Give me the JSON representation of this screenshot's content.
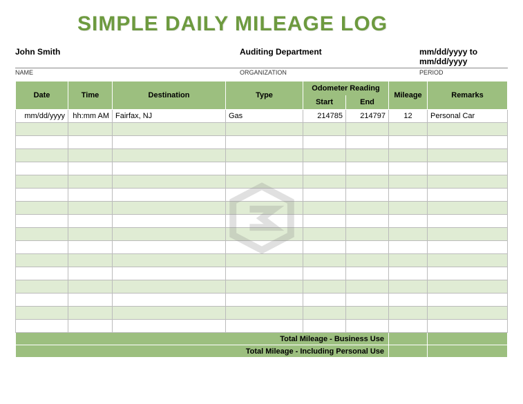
{
  "title": "SIMPLE DAILY MILEAGE LOG",
  "meta": {
    "name_value": "John Smith",
    "name_label": "NAME",
    "org_value": "Auditing Department",
    "org_label": "ORGANIZATION",
    "period_value": "mm/dd/yyyy to mm/dd/yyyy",
    "period_label": "PERIOD"
  },
  "headers": {
    "date": "Date",
    "time": "Time",
    "destination": "Destination",
    "type": "Type",
    "odometer": "Odometer Reading",
    "start": "Start",
    "end": "End",
    "mileage": "Mileage",
    "remarks": "Remarks"
  },
  "rows": [
    {
      "date": "mm/dd/yyyy",
      "time": "hh:mm AM",
      "destination": "Fairfax, NJ",
      "type": "Gas",
      "start": "214785",
      "end": "214797",
      "mileage": "12",
      "remarks": "Personal Car"
    },
    {
      "date": "",
      "time": "",
      "destination": "",
      "type": "",
      "start": "",
      "end": "",
      "mileage": "",
      "remarks": ""
    },
    {
      "date": "",
      "time": "",
      "destination": "",
      "type": "",
      "start": "",
      "end": "",
      "mileage": "",
      "remarks": ""
    },
    {
      "date": "",
      "time": "",
      "destination": "",
      "type": "",
      "start": "",
      "end": "",
      "mileage": "",
      "remarks": ""
    },
    {
      "date": "",
      "time": "",
      "destination": "",
      "type": "",
      "start": "",
      "end": "",
      "mileage": "",
      "remarks": ""
    },
    {
      "date": "",
      "time": "",
      "destination": "",
      "type": "",
      "start": "",
      "end": "",
      "mileage": "",
      "remarks": ""
    },
    {
      "date": "",
      "time": "",
      "destination": "",
      "type": "",
      "start": "",
      "end": "",
      "mileage": "",
      "remarks": ""
    },
    {
      "date": "",
      "time": "",
      "destination": "",
      "type": "",
      "start": "",
      "end": "",
      "mileage": "",
      "remarks": ""
    },
    {
      "date": "",
      "time": "",
      "destination": "",
      "type": "",
      "start": "",
      "end": "",
      "mileage": "",
      "remarks": ""
    },
    {
      "date": "",
      "time": "",
      "destination": "",
      "type": "",
      "start": "",
      "end": "",
      "mileage": "",
      "remarks": ""
    },
    {
      "date": "",
      "time": "",
      "destination": "",
      "type": "",
      "start": "",
      "end": "",
      "mileage": "",
      "remarks": ""
    },
    {
      "date": "",
      "time": "",
      "destination": "",
      "type": "",
      "start": "",
      "end": "",
      "mileage": "",
      "remarks": ""
    },
    {
      "date": "",
      "time": "",
      "destination": "",
      "type": "",
      "start": "",
      "end": "",
      "mileage": "",
      "remarks": ""
    },
    {
      "date": "",
      "time": "",
      "destination": "",
      "type": "",
      "start": "",
      "end": "",
      "mileage": "",
      "remarks": ""
    },
    {
      "date": "",
      "time": "",
      "destination": "",
      "type": "",
      "start": "",
      "end": "",
      "mileage": "",
      "remarks": ""
    },
    {
      "date": "",
      "time": "",
      "destination": "",
      "type": "",
      "start": "",
      "end": "",
      "mileage": "",
      "remarks": ""
    },
    {
      "date": "",
      "time": "",
      "destination": "",
      "type": "",
      "start": "",
      "end": "",
      "mileage": "",
      "remarks": ""
    }
  ],
  "footer": {
    "business": "Total Mileage - Business Use",
    "personal": "Total Mileage - Including Personal Use"
  }
}
